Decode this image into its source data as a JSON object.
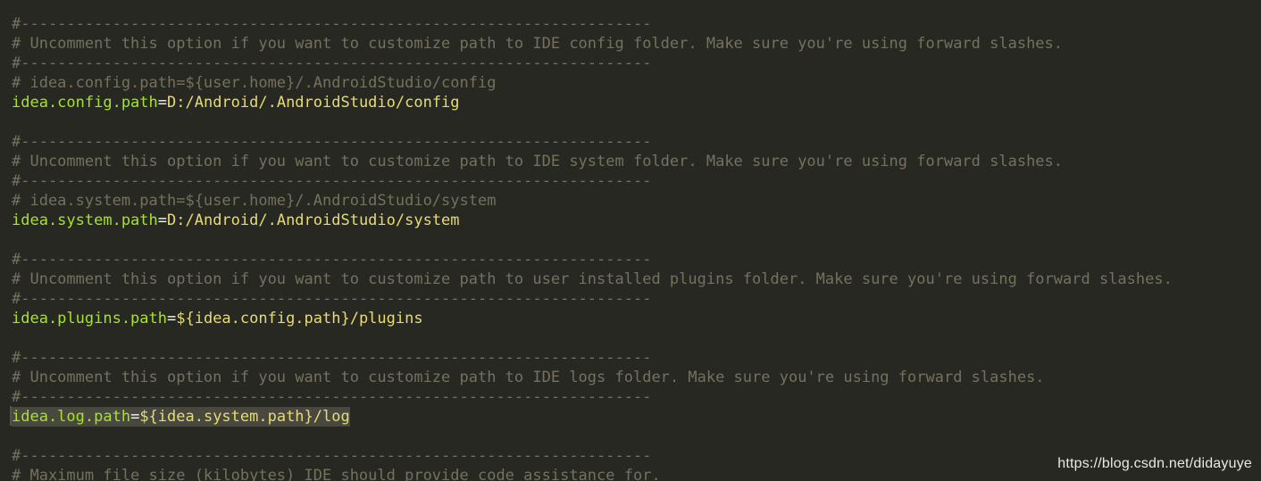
{
  "colors": {
    "background": "#272822",
    "comment": "#75715e",
    "key": "#a6e22e",
    "value": "#e6db74",
    "selection": "#49483e"
  },
  "lines": [
    {
      "type": "comment",
      "text": "#---------------------------------------------------------------------"
    },
    {
      "type": "comment",
      "text": "# Uncomment this option if you want to customize path to IDE config folder. Make sure you're using forward slashes."
    },
    {
      "type": "comment",
      "text": "#---------------------------------------------------------------------"
    },
    {
      "type": "comment",
      "text": "# idea.config.path=${user.home}/.AndroidStudio/config"
    },
    {
      "type": "prop",
      "key": "idea.config.path",
      "eq": "=",
      "value": "D:/Android/.AndroidStudio/config"
    },
    {
      "type": "blank",
      "text": ""
    },
    {
      "type": "comment",
      "text": "#---------------------------------------------------------------------"
    },
    {
      "type": "comment",
      "text": "# Uncomment this option if you want to customize path to IDE system folder. Make sure you're using forward slashes."
    },
    {
      "type": "comment",
      "text": "#---------------------------------------------------------------------"
    },
    {
      "type": "comment",
      "text": "# idea.system.path=${user.home}/.AndroidStudio/system"
    },
    {
      "type": "prop",
      "key": "idea.system.path",
      "eq": "=",
      "value": "D:/Android/.AndroidStudio/system"
    },
    {
      "type": "blank",
      "text": ""
    },
    {
      "type": "comment",
      "text": "#---------------------------------------------------------------------"
    },
    {
      "type": "comment",
      "text": "# Uncomment this option if you want to customize path to user installed plugins folder. Make sure you're using forward slashes."
    },
    {
      "type": "comment",
      "text": "#---------------------------------------------------------------------"
    },
    {
      "type": "prop",
      "key": "idea.plugins.path",
      "eq": "=",
      "value": "${idea.config.path}/plugins"
    },
    {
      "type": "blank",
      "text": ""
    },
    {
      "type": "comment",
      "text": "#---------------------------------------------------------------------"
    },
    {
      "type": "comment",
      "text": "# Uncomment this option if you want to customize path to IDE logs folder. Make sure you're using forward slashes."
    },
    {
      "type": "comment",
      "text": "#---------------------------------------------------------------------"
    },
    {
      "type": "prop",
      "key": "idea.log.path",
      "eq": "=",
      "value": "${idea.system.path}/log",
      "highlighted": true
    },
    {
      "type": "blank",
      "text": ""
    },
    {
      "type": "comment",
      "text": "#---------------------------------------------------------------------"
    },
    {
      "type": "comment",
      "text": "# Maximum file size (kilobytes) IDE should provide code assistance for."
    }
  ],
  "watermark": "https://blog.csdn.net/didayuye"
}
